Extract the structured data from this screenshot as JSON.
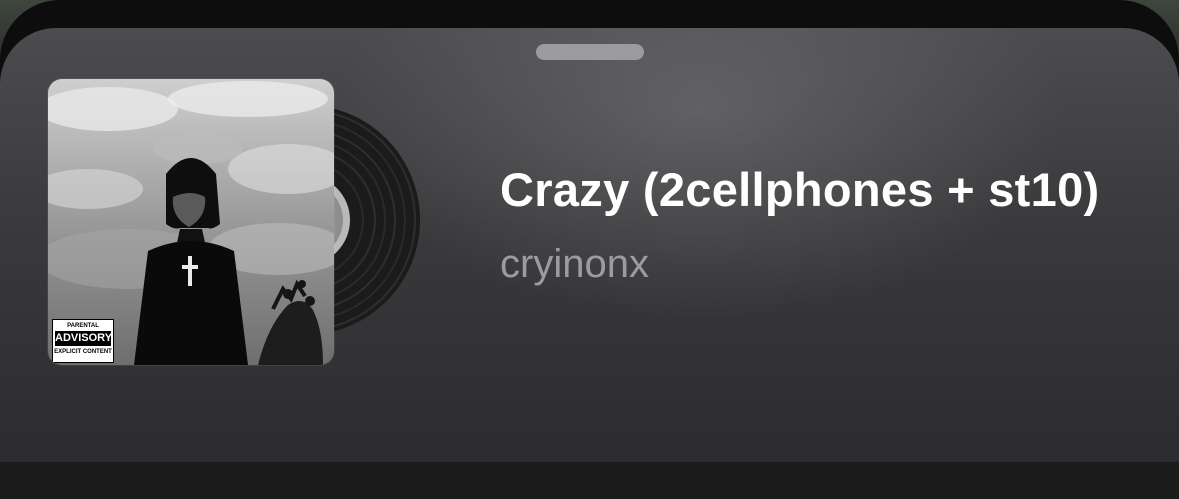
{
  "now_playing": {
    "title": "Crazy (2cellphones + st10)",
    "artist": "cryinonx"
  },
  "album_art": {
    "parental_label_top": "PARENTAL",
    "parental_label_mid": "ADVISORY",
    "parental_label_bottom": "EXPLICIT CONTENT"
  }
}
